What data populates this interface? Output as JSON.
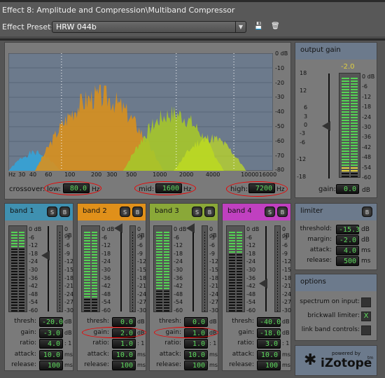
{
  "window": {
    "title": "Effect 8: Amplitude and Compression\\Multiband Compressor"
  },
  "preset": {
    "label": "Effect Preset:",
    "value": "HRW 044b",
    "icons": [
      "dropdown-arrow-icon",
      "save-icon",
      "trash-icon"
    ]
  },
  "spectrum": {
    "freq_ticks": [
      "Hz",
      "30",
      "40",
      "60",
      "100",
      "200",
      "300",
      "500",
      "1000",
      "2000",
      "4000",
      "10000",
      "16000"
    ],
    "db_ticks": [
      "0 dB",
      "-10",
      "-20",
      "-30",
      "-40",
      "-50",
      "-60",
      "-70",
      "-80"
    ],
    "crossover_label": "crossover:",
    "low": {
      "label": "low:",
      "value": "80.0",
      "unit": "Hz"
    },
    "mid": {
      "label": "mid:",
      "value": "1600",
      "unit": "Hz"
    },
    "high": {
      "label": "high:",
      "value": "7200",
      "unit": "Hz"
    },
    "band_colors": [
      "#3a9fd0",
      "#d8901e",
      "#a6c62a",
      "#c3e020"
    ]
  },
  "meter_ticks_left": [
    "0 dB",
    "-6",
    "-12",
    "-18",
    "-24",
    "-30",
    "-36",
    "-42",
    "-48",
    "-54",
    "-60"
  ],
  "meter_ticks_right": [
    "0 dB",
    "-3",
    "-6",
    "-9",
    "-12",
    "-15",
    "-18",
    "-21",
    "-24",
    "-27",
    "-30"
  ],
  "param_labels": {
    "thresh": "thresh:",
    "gain": "gain:",
    "ratio": "ratio:",
    "attack": "attack:",
    "release": "release:"
  },
  "param_units": {
    "thresh": "dB",
    "gain": "dB",
    "ratio": ": 1",
    "attack": "ms",
    "release": "ms"
  },
  "bands": [
    {
      "name": "band 1",
      "color": "#3f90b0",
      "solo": "S",
      "bypass": "B",
      "level_db": -46,
      "fader_db": -20,
      "thresh": "-20.0",
      "gain": "-3.0",
      "ratio": "4.0",
      "attack": "10.0",
      "release": "100"
    },
    {
      "name": "band 2",
      "color": "#e0901a",
      "solo": "S",
      "bypass": "B",
      "level_db": -10,
      "fader_db": 0,
      "thresh": "0.0",
      "gain": "2.0",
      "ratio": "1.0",
      "attack": "10.0",
      "release": "100"
    },
    {
      "name": "band 3",
      "color": "#8aa838",
      "solo": "S",
      "bypass": "B",
      "level_db": -16,
      "fader_db": 0,
      "thresh": "0.0",
      "gain": "1.0",
      "ratio": "1.0",
      "attack": "10.0",
      "release": "100"
    },
    {
      "name": "band 4",
      "color": "#c040c0",
      "solo": "S",
      "bypass": "B",
      "level_db": -42,
      "fader_db": -40,
      "thresh": "-40.0",
      "gain": "-18.0",
      "ratio": "3.0",
      "attack": "10.0",
      "release": "100"
    }
  ],
  "output": {
    "title": "output gain",
    "peak": "-2.0",
    "gain_label": "gain:",
    "gain_value": "0.0",
    "gain_unit": "dB",
    "level_db": -2,
    "fader_ticks": [
      "18",
      "12",
      "6",
      "3",
      "0",
      "-3",
      "-6",
      "-12",
      "-18"
    ],
    "meter_ticks": [
      "0 dB",
      "-6",
      "-12",
      "-18",
      "-24",
      "-30",
      "-36",
      "-42",
      "-48",
      "-54",
      "-60"
    ]
  },
  "limiter": {
    "title": "limiter",
    "bypass": "B",
    "rows": [
      {
        "label": "threshold:",
        "value": "-15.3",
        "unit": "dB"
      },
      {
        "label": "margin:",
        "value": "-2.0",
        "unit": "dB"
      },
      {
        "label": "attack:",
        "value": "4.0",
        "unit": "ms"
      },
      {
        "label": "release:",
        "value": "500",
        "unit": "ms"
      }
    ]
  },
  "options": {
    "title": "options",
    "rows": [
      {
        "label": "spectrum on input:",
        "checked": false,
        "mark": ""
      },
      {
        "label": "brickwall limiter:",
        "checked": true,
        "mark": "X"
      },
      {
        "label": "link band controls:",
        "checked": false,
        "mark": ""
      }
    ]
  },
  "logo": {
    "powered": "powered by",
    "brand": "iZotope",
    "tm": "tm"
  }
}
